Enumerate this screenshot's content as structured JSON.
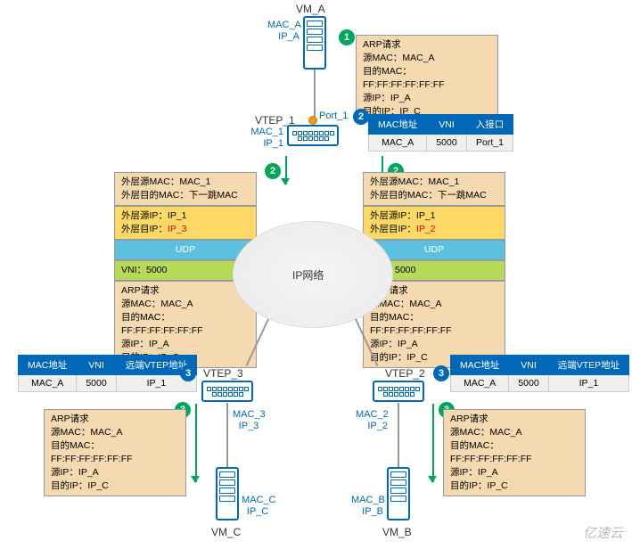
{
  "vm_a": {
    "title": "VM_A",
    "mac": "MAC_A",
    "ip": "IP_A"
  },
  "vm_b": {
    "title": "VM_B",
    "mac": "MAC_B",
    "ip": "IP_B"
  },
  "vm_c": {
    "title": "VM_C",
    "mac": "MAC_C",
    "ip": "IP_C"
  },
  "vtep1": {
    "title": "VTEP_1",
    "mac": "MAC_1",
    "ip": "IP_1",
    "port": "Port_1"
  },
  "vtep2": {
    "title": "VTEP_2",
    "mac": "MAC_2",
    "ip": "IP_2"
  },
  "vtep3": {
    "title": "VTEP_3",
    "mac": "MAC_3",
    "ip": "IP_3"
  },
  "cloud_label": "IP网络",
  "steps": {
    "s1": "1",
    "s2": "2",
    "s3": "3"
  },
  "arp_packet": {
    "title": "ARP请求",
    "src_mac": "源MAC：MAC_A",
    "dst_mac": "目的MAC：FF:FF:FF:FF:FF:FF",
    "src_ip": "源IP：IP_A",
    "dst_ip": "目的IP：IP_C"
  },
  "outer_left": {
    "mac_src": "外层源MAC：MAC_1",
    "mac_dst": "外层目的MAC：下一跳MAC",
    "ip_src": "外层源IP：IP_1",
    "ip_dst_pref": "外层目IP：",
    "ip_dst_val": "IP_3",
    "udp": "UDP",
    "vni": "VNI：5000"
  },
  "outer_right": {
    "mac_src": "外层源MAC：MAC_1",
    "mac_dst": "外层目的MAC：下一跳MAC",
    "ip_src": "外层源IP：IP_1",
    "ip_dst_pref": "外层目IP：",
    "ip_dst_val": "IP_2",
    "udp": "UDP",
    "vni": "VNI：5000"
  },
  "mac_table_top": {
    "h1": "MAC地址",
    "h2": "VNI",
    "h3": "入接口",
    "c1": "MAC_A",
    "c2": "5000",
    "c3": "Port_1"
  },
  "mac_table_left": {
    "h1": "MAC地址",
    "h2": "VNI",
    "h3": "远端VTEP地址",
    "c1": "MAC_A",
    "c2": "5000",
    "c3": "IP_1"
  },
  "mac_table_right": {
    "h1": "MAC地址",
    "h2": "VNI",
    "h3": "远端VTEP地址",
    "c1": "MAC_A",
    "c2": "5000",
    "c3": "IP_1"
  },
  "watermark": "亿速云"
}
